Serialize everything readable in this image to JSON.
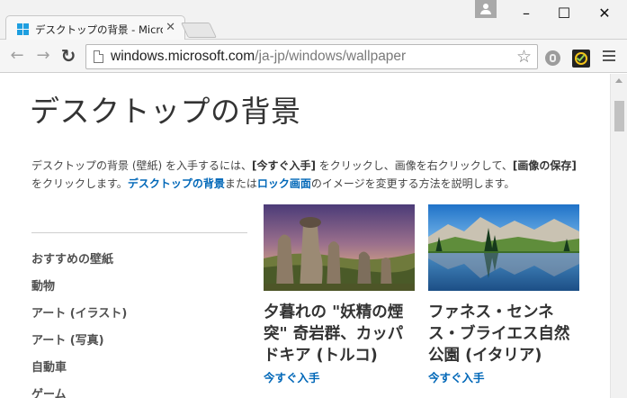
{
  "browser": {
    "tab": {
      "title": "デスクトップの背景 - Microsoft"
    },
    "address": {
      "host": "windows.microsoft.com",
      "path": "/ja-jp/windows/wallpaper"
    }
  },
  "page": {
    "title": "デスクトップの背景",
    "intro": {
      "p1": "デスクトップの背景 (壁紙) を入手するには、",
      "k1": "[今すぐ入手]",
      "p2": " をクリックし、画像を右クリックして、",
      "k2": "[画像の保存]",
      "p3": " をクリックします。",
      "link1": "デスクトップの背景",
      "p4": "または",
      "link2": "ロック画面",
      "p5": "のイメージを変更する方法を説明します。"
    },
    "categories": [
      "おすすめの壁紙",
      "動物",
      "アート (イラスト)",
      "アート (写真)",
      "自動車",
      "ゲーム"
    ],
    "cards": [
      {
        "title": "夕暮れの \"妖精の煙突\" 奇岩群、カッパドキア (トルコ)",
        "cta": "今すぐ入手"
      },
      {
        "title": "ファネス・センネス・ブライエス自然公園 (イタリア)",
        "cta": "今すぐ入手"
      }
    ]
  },
  "colors": {
    "link": "#0067b8",
    "text": "#333333"
  }
}
